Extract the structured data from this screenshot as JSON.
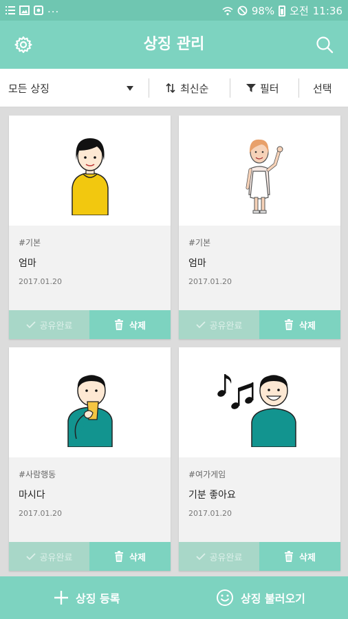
{
  "status_bar": {
    "battery": "98%",
    "ampm": "오전",
    "time": "11:36",
    "more": "..."
  },
  "app_bar": {
    "title": "상징 관리",
    "left_icon": "gear-icon",
    "right_icon": "search-icon"
  },
  "filter_bar": {
    "category": "모든 상징",
    "sort": "최신순",
    "filter": "필터",
    "select": "선택"
  },
  "cards": [
    {
      "tag": "#기본",
      "name": "엄마",
      "date": "2017.01.20",
      "share": "공유완료",
      "delete": "삭제",
      "image": "woman-yellow-sweater"
    },
    {
      "tag": "#기본",
      "name": "엄마",
      "date": "2017.01.20",
      "share": "공유완료",
      "delete": "삭제",
      "image": "woman-apron-waving"
    },
    {
      "tag": "#사람행동",
      "name": "마시다",
      "date": "2017.01.20",
      "share": "공유완료",
      "delete": "삭제",
      "image": "man-drinking"
    },
    {
      "tag": "#여가게임",
      "name": "기분 좋아요",
      "date": "2017.01.20",
      "share": "공유완료",
      "delete": "삭제",
      "image": "man-happy-music"
    }
  ],
  "bottom_bar": {
    "register": "상징 등록",
    "import": "상징 불러오기"
  },
  "colors": {
    "status_bar": "#6fc6b1",
    "accent": "#7dd3c0",
    "share_done": "#a8d7c8"
  }
}
